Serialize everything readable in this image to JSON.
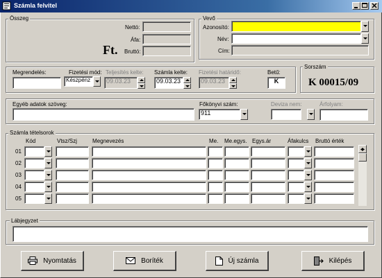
{
  "window": {
    "title": "Számla felvitel"
  },
  "osszeg": {
    "legend": "Összeg",
    "netto_label": "Nettó:",
    "afa_label": "Áfa:",
    "brutto_label": "Bruttó:",
    "currency": "Ft.",
    "netto_value": "",
    "afa_value": "",
    "brutto_value": ""
  },
  "vevo": {
    "legend": "Vevő",
    "azonosito_label": "Azonosító:",
    "nev_label": "Név:",
    "cim_label": "Cím:",
    "azonosito_value": "",
    "nev_value": "",
    "cim_value": ""
  },
  "order": {
    "megrendeles_label": "Megrendelés:",
    "megrendeles_value": "",
    "fizetesi_mod_label": "Fizetési mód:",
    "fizetesi_mod_value": "Készpénz",
    "teljesites_label": "Teljesítés kelte:",
    "teljesites_value": "09.03.23",
    "szamla_kelte_label": "Számla kelte:",
    "szamla_kelte_value": "09.03.23",
    "fizetesi_hatarido_label": "Fizetési határidő:",
    "fizetesi_hatarido_value": "09.03.23",
    "betu_label": "Betű:",
    "betu_value": "K"
  },
  "sorszam": {
    "legend": "Sorszám",
    "value": "K 00015/09"
  },
  "misc": {
    "egyeb_label": "Egyéb adatok szöveg:",
    "egyeb_value": "",
    "fokonyvi_label": "Főkönyvi szám:",
    "fokonyvi_value": "911",
    "deviza_label": "Deviza nem:",
    "deviza_value": "",
    "arfolyam_label": "Árfolyam:",
    "arfolyam_value": ""
  },
  "items": {
    "legend": "Számla tételsorok",
    "headers": {
      "kod": "Kód",
      "vtsz": "Vtsz/Szj",
      "megnevezes": "Megnevezés",
      "me": "Me.",
      "meegys": "Me.egys.",
      "egysar": "Egys.ár",
      "afakulcs": "Áfakulcs",
      "brutto": "Bruttó érték"
    },
    "rows": [
      "01",
      "02",
      "03",
      "04",
      "05"
    ]
  },
  "labjegyzet": {
    "legend": "Lábjegyzet",
    "value": ""
  },
  "buttons": {
    "print": "Nyomtatás",
    "envelope": "Boríték",
    "new_invoice": "Új számla",
    "exit": "Kilépés"
  },
  "colors": {
    "titlebar": "#0a246a",
    "highlight": "#ffff00",
    "face": "#d4d0c8"
  }
}
